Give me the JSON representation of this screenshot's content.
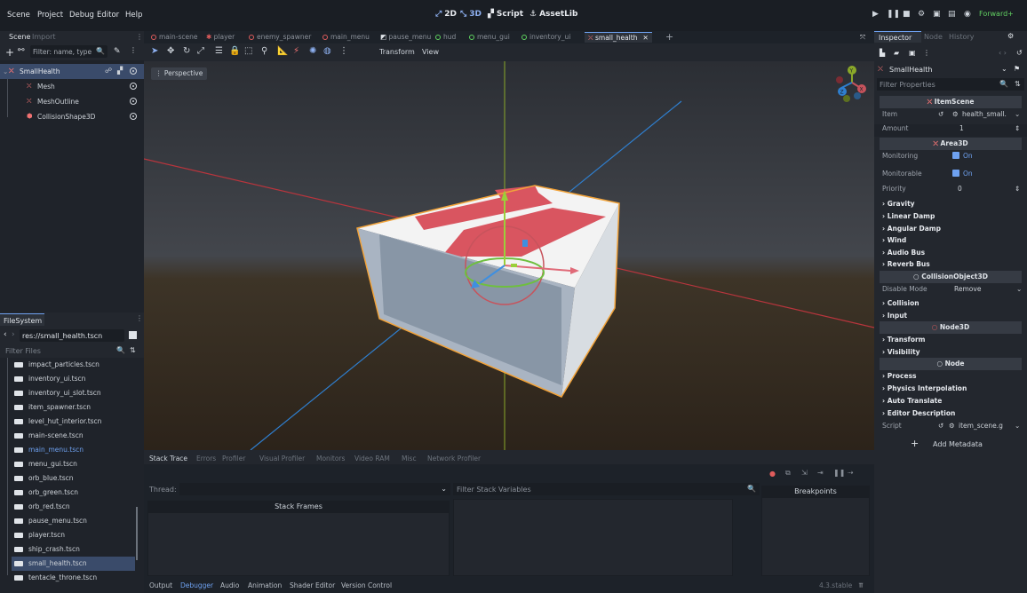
{
  "menu": [
    "Scene",
    "Project",
    "Debug",
    "Editor",
    "Help"
  ],
  "modes": {
    "m2d": "2D",
    "m3d": "3D",
    "script": "Script",
    "assetlib": "AssetLib"
  },
  "renderer": "Forward+",
  "left_tabs": {
    "scene": "Scene",
    "import": "Import"
  },
  "scene_filter_placeholder": "Filter: name, type",
  "scene_tree": [
    {
      "label": "SmallHealth",
      "icon": "scene-icon"
    },
    {
      "label": "Mesh",
      "icon": "mesh-icon"
    },
    {
      "label": "MeshOutline",
      "icon": "mesh-icon"
    },
    {
      "label": "CollisionShape3D",
      "icon": "collision-shape-icon"
    }
  ],
  "filesystem": {
    "title": "FileSystem",
    "path": "res://small_health.tscn",
    "filter_placeholder": "Filter Files",
    "files": [
      "impact_particles.tscn",
      "inventory_ui.tscn",
      "inventory_ui_slot.tscn",
      "item_spawner.tscn",
      "level_hut_interior.tscn",
      "main-scene.tscn",
      "main_menu.tscn",
      "menu_gui.tscn",
      "orb_blue.tscn",
      "orb_green.tscn",
      "orb_red.tscn",
      "pause_menu.tscn",
      "player.tscn",
      "ship_crash.tscn",
      "small_health.tscn",
      "tentacle_throne.tscn"
    ]
  },
  "scene_tabs": [
    "main-scene",
    "player",
    "enemy_spawner",
    "main_menu",
    "pause_menu",
    "hud",
    "menu_gui",
    "inventory_ui",
    "small_health"
  ],
  "viewport_menus": {
    "transform": "Transform",
    "view": "View"
  },
  "viewport_label": "Perspective",
  "gizmo_axes": {
    "x": "X",
    "y": "Y",
    "z": "Z"
  },
  "bottom_tabs": [
    "Stack Trace",
    "Errors",
    "Profiler",
    "Visual Profiler",
    "Monitors",
    "Video RAM",
    "Misc",
    "Network Profiler"
  ],
  "debugger": {
    "thread_label": "Thread:",
    "filter_placeholder": "Filter Stack Variables",
    "stack_frames": "Stack Frames",
    "breakpoints": "Breakpoints"
  },
  "output_tabs": [
    "Output",
    "Debugger",
    "Audio",
    "Animation",
    "Shader Editor",
    "Version Control"
  ],
  "version": "4.3.stable",
  "inspector": {
    "tabs": {
      "inspector": "Inspector",
      "node": "Node",
      "history": "History"
    },
    "node_name": "SmallHealth",
    "filter_placeholder": "Filter Properties",
    "sections": {
      "itemscene": "ItemScene",
      "area3d": "Area3D",
      "collisionobject3d": "CollisionObject3D",
      "node3d": "Node3D",
      "node": "Node"
    },
    "props": {
      "item_label": "Item",
      "item_value": "health_small.",
      "amount_label": "Amount",
      "amount_value": "1",
      "monitoring_label": "Monitoring",
      "monitoring_value": "On",
      "monitorable_label": "Monitorable",
      "monitorable_value": "On",
      "priority_label": "Priority",
      "priority_value": "0",
      "disable_mode_label": "Disable Mode",
      "disable_mode_value": "Remove",
      "script_label": "Script",
      "script_value": "item_scene.g"
    },
    "groups_area3d": [
      "Gravity",
      "Linear Damp",
      "Angular Damp",
      "Wind",
      "Audio Bus",
      "Reverb Bus"
    ],
    "groups_collision": [
      "Collision",
      "Input"
    ],
    "groups_node3d": [
      "Transform",
      "Visibility"
    ],
    "groups_node": [
      "Process",
      "Physics Interpolation",
      "Auto Translate",
      "Editor Description"
    ],
    "add_metadata": "Add Metadata"
  }
}
